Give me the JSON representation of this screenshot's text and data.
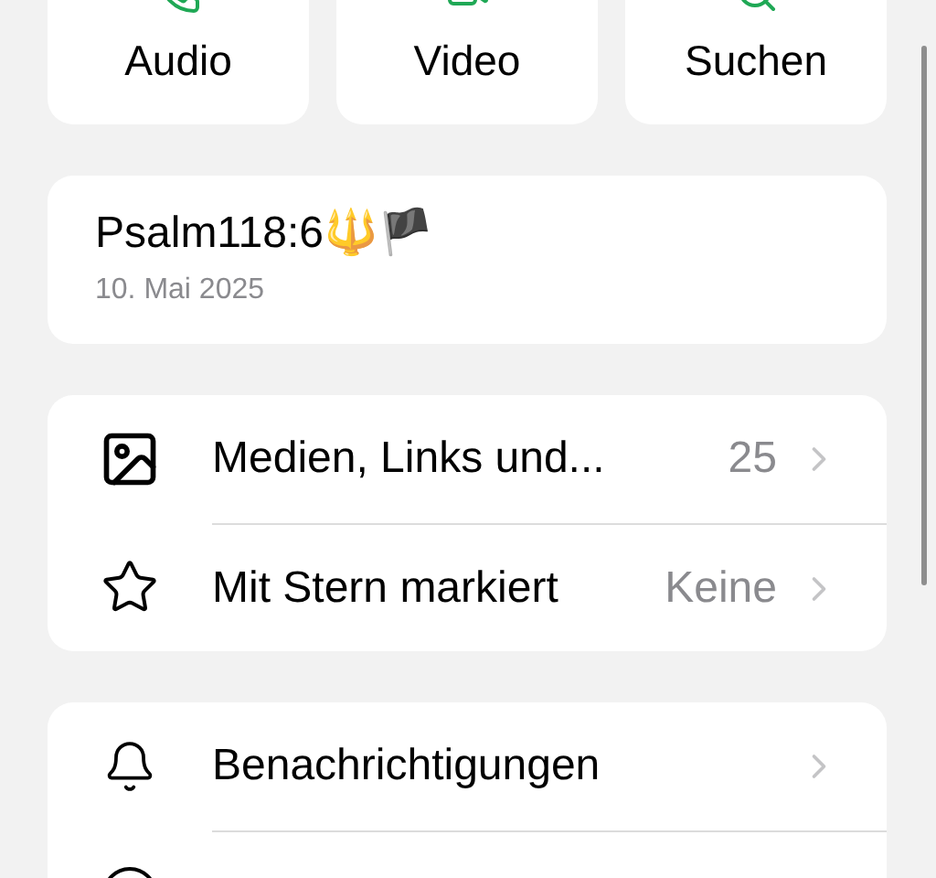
{
  "actions": [
    {
      "kind": "audio",
      "label": "Audio"
    },
    {
      "kind": "video",
      "label": "Video"
    },
    {
      "kind": "search",
      "label": "Suchen"
    }
  ],
  "info": {
    "name": "Psalm118:6🔱🏴",
    "date": "10. Mai 2025"
  },
  "groups": [
    [
      {
        "kind": "media",
        "label": "Medien, Links und...",
        "value": "25"
      },
      {
        "kind": "star",
        "label": "Mit Stern markiert",
        "value": "Keine"
      }
    ],
    [
      {
        "kind": "bell",
        "label": "Benachrichtigungen"
      }
    ]
  ]
}
